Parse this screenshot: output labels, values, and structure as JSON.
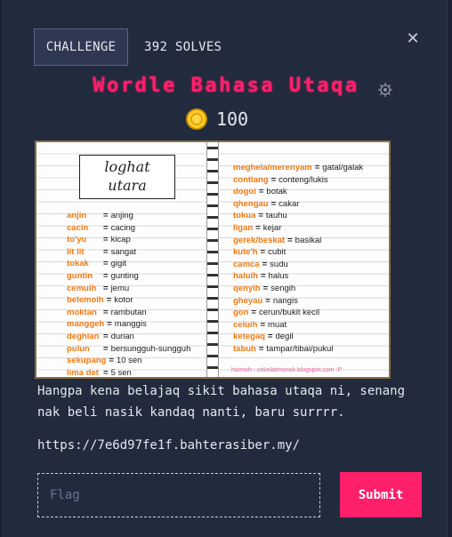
{
  "tabs": {
    "challenge_label": "CHALLENGE",
    "solves_label": "392 SOLVES"
  },
  "close_icon": "close-icon",
  "challenge": {
    "title": "Wordle Bahasa Utaqa",
    "points": "100",
    "description": "Hangpa kena belajaq sikit bahasa utaqa ni, senang nak beli nasik kandaq nanti, baru surrrr.",
    "link": "https://7e6d97fe1f.bahterasiber.my/"
  },
  "notebook": {
    "hand_title_line1": "loghat",
    "hand_title_line2": "utara",
    "left_words": [
      {
        "k": "anjin",
        "v": "anjing"
      },
      {
        "k": "cacin",
        "v": "cacing"
      },
      {
        "k": "to'yu",
        "v": "kicap"
      },
      {
        "k": "lit lit",
        "v": "sangat"
      },
      {
        "k": "tokak",
        "v": "gigit"
      },
      {
        "k": "guntin",
        "v": "gunting"
      },
      {
        "k": "cemuih",
        "v": "jemu"
      },
      {
        "k": "belemoih",
        "v": "kotor"
      },
      {
        "k": "moktan",
        "v": "rambutan"
      },
      {
        "k": "manggeh",
        "v": "manggis"
      },
      {
        "k": "deghian",
        "v": "durian"
      },
      {
        "k": "pulun",
        "v": "bersungguh-sungguh"
      },
      {
        "k": "sekupang",
        "v": "10 sen"
      },
      {
        "k": "lima det",
        "v": "5 sen"
      }
    ],
    "right_words": [
      {
        "k": "meghela/merenyam",
        "v": "gatal/galak"
      },
      {
        "k": "contiang",
        "v": "conteng/lukis"
      },
      {
        "k": "dogoi",
        "v": "botak"
      },
      {
        "k": "qhengau",
        "v": "cakar"
      },
      {
        "k": "tokua",
        "v": "tauhu"
      },
      {
        "k": "ligan",
        "v": "kejar"
      },
      {
        "k": "gerek/beskat",
        "v": "basikal"
      },
      {
        "k": "kute'h",
        "v": "cubit"
      },
      {
        "k": "camca",
        "v": "sudu"
      },
      {
        "k": "haluih",
        "v": "halus"
      },
      {
        "k": "qenyih",
        "v": "sengih"
      },
      {
        "k": "gheyau",
        "v": "nangis"
      },
      {
        "k": "gon",
        "v": "cerun/bukit kecil"
      },
      {
        "k": "celuih",
        "v": "muat"
      },
      {
        "k": "ketegaq",
        "v": "degil"
      },
      {
        "k": "tabuh",
        "v": "tampar/tibai/pukul"
      }
    ],
    "footer": "hamoih : cekelatmonok.blogspot.com :P"
  },
  "form": {
    "flag_placeholder": "Flag",
    "submit_label": "Submit"
  },
  "colors": {
    "accent": "#ff1f6b",
    "background": "#222a3e",
    "vocab_key": "#f07a10"
  }
}
